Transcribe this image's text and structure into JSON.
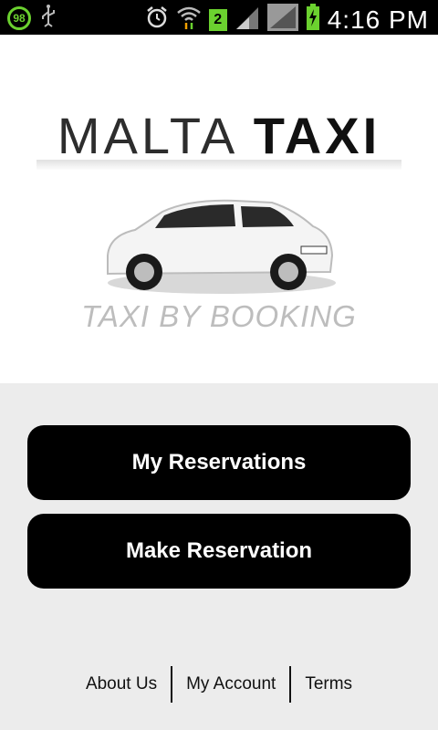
{
  "status_bar": {
    "battery_level": "98",
    "notification_count": "2",
    "time": "4:16 PM",
    "accent_color": "#6bd12f",
    "icons": [
      "usb-icon",
      "alarm-icon",
      "wifi-icon",
      "signal-icon",
      "signal-icon",
      "battery-charging-icon"
    ]
  },
  "header": {
    "logo_part1": "MALTA",
    "logo_part2": "TAXI",
    "tagline": "TAXI BY BOOKING"
  },
  "buttons": {
    "my_reservations": "My Reservations",
    "make_reservation": "Make Reservation"
  },
  "footer": {
    "about_us": "About Us",
    "my_account": "My Account",
    "terms": "Terms"
  },
  "colors": {
    "button_bg": "#000000",
    "page_bg": "#ececec"
  }
}
